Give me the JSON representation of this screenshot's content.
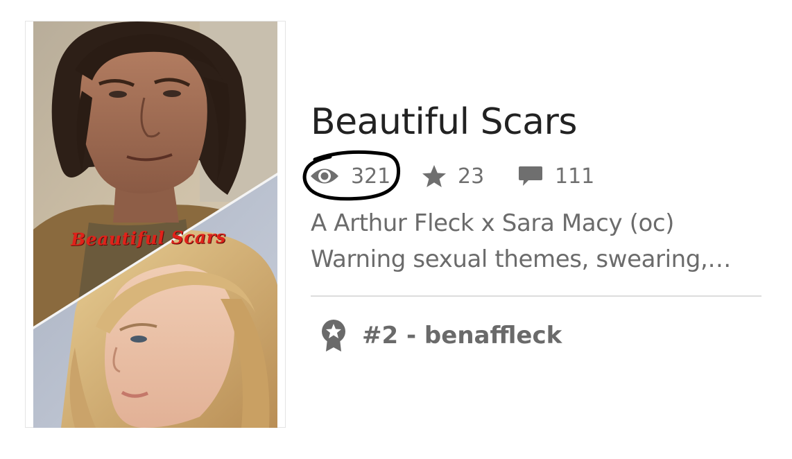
{
  "story": {
    "title": "Beautiful Scars",
    "cover_text": "Beautiful Scars",
    "stats": {
      "reads": "321",
      "reads_icon": "eye-icon",
      "votes": "23",
      "votes_icon": "star-icon",
      "comments": "111",
      "comments_icon": "comment-icon"
    },
    "description_lines": [
      "A Arthur Fleck x Sara Macy (oc)",
      "Warning sexual themes, swearing,…"
    ],
    "rank": {
      "icon": "award-ribbon-icon",
      "label": "#2 - benaffleck"
    }
  },
  "colors": {
    "title": "#222222",
    "meta": "#6f6f6f",
    "cover_text": "#e0221a",
    "annotation": "#000000"
  }
}
